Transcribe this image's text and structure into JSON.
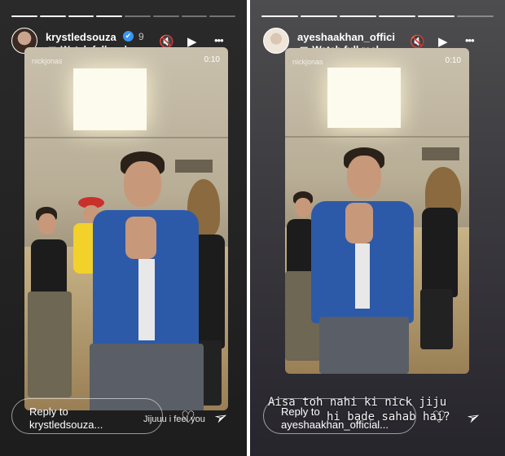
{
  "stories": [
    {
      "id": "left",
      "username": "krystledsouza",
      "verified_mark": "✔",
      "age": "9",
      "reel_label": "Watch full reel",
      "watermark": "nickjonas",
      "timer": "0:10",
      "reply_line1": "Reply to",
      "reply_line2": "krystledsouza...",
      "caption": "Jijuuu i feel you",
      "progress": [
        1,
        1,
        1,
        1,
        0,
        0,
        0,
        0
      ]
    },
    {
      "id": "right",
      "username": "ayeshaakhan_offici",
      "reel_label": "Watch full reel",
      "watermark": "nickjonas",
      "timer": "0:10",
      "overlay_line1": "Aisa toh nahi ki nick jiju",
      "overlay_line2": "hi bade sahab hai?",
      "reply_line1": "Reply to",
      "reply_line2": "ayeshaakhan_official...",
      "progress": [
        1,
        1,
        1,
        1,
        1,
        0
      ]
    }
  ],
  "icons": {
    "mute": "🔇",
    "play": "▶",
    "more": "•••",
    "heart": "♡",
    "send": "➢",
    "chevron": "›",
    "reel": "▣"
  }
}
